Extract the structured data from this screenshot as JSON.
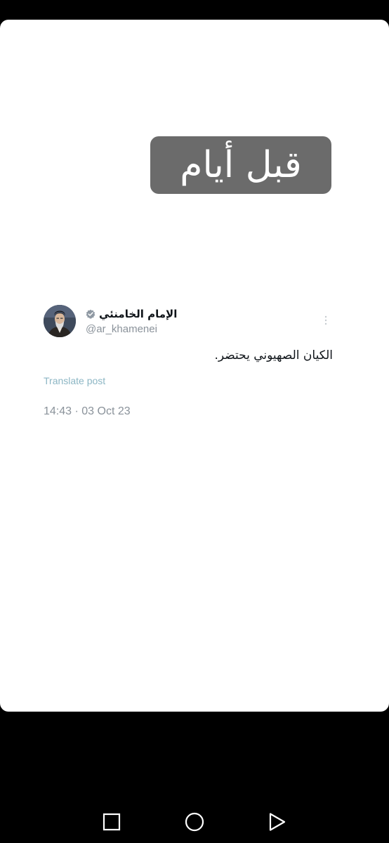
{
  "caption": {
    "text": "قبل أيام",
    "background_color": "#6b6b6b"
  },
  "tweet": {
    "display_name": "الإمام الخامنئي",
    "verified_icon": "verified-badge-icon",
    "handle": "@ar_khamenei",
    "text": "الكيان الصهيوني يحتضر.",
    "translate_label": "Translate post",
    "timestamp": "14:43 · 03 Oct 23",
    "more_icon": "more-options-icon"
  },
  "navigation_bar": {
    "recents_icon": "square-recents-icon",
    "home_icon": "circle-home-icon",
    "back_icon": "triangle-back-icon"
  },
  "colors": {
    "background": "#000000",
    "card": "#ffffff",
    "muted_text": "#8a929a",
    "link": "#8cb6c4"
  }
}
